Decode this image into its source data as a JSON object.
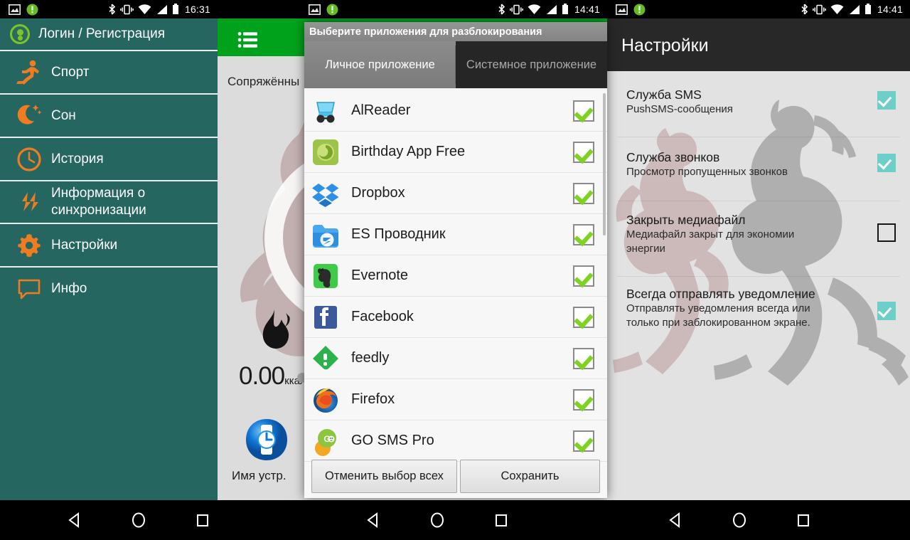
{
  "panels": {
    "drawer": {
      "statusbar": {
        "clock": "16:31",
        "icons_left": [
          "image-icon",
          "alert-badge-icon"
        ],
        "icons_right": [
          "bluetooth-icon",
          "vibrate-icon",
          "wifi-icon",
          "signal-icon",
          "battery-icon"
        ]
      },
      "header": {
        "label": "Логин / Регистрация",
        "icon": "account-avatar-icon"
      },
      "items": [
        {
          "label": "Спорт",
          "icon": "runner-icon"
        },
        {
          "label": "Сон",
          "icon": "moon-stars-icon"
        },
        {
          "label": "История",
          "icon": "clock-icon"
        },
        {
          "label": "Информация о синхронизации",
          "icon": "sync-icon"
        },
        {
          "label": "Настройки",
          "icon": "gear-icon"
        },
        {
          "label": "Инфо",
          "icon": "speech-bubble-icon"
        }
      ]
    },
    "tracker": {
      "appbar_icon": "list-menu-icon",
      "paired_label": "Сопряжённы",
      "calories_value": "0.00",
      "calories_unit": "ккал",
      "flame_icon": "flame-icon",
      "device_icon": "watch-icon",
      "device_label": "Имя устр."
    },
    "settings": {
      "statusbar": {
        "clock": "14:41",
        "icons_left": [
          "image-icon",
          "alert-badge-icon"
        ],
        "icons_right": [
          "bluetooth-icon",
          "vibrate-icon",
          "wifi-icon",
          "signal-icon",
          "battery-icon"
        ]
      },
      "title": "Настройки",
      "rows": [
        {
          "title": "Служба SMS",
          "subtitle": "PushSMS-сообщения",
          "checked": true
        },
        {
          "title": "Служба звонков",
          "subtitle": "Просмотр пропущенных звонков",
          "checked": true
        },
        {
          "title": "Закрыть медиафайл",
          "subtitle": "Медиафайл закрыт для экономии энергии",
          "checked": false
        },
        {
          "title": "Всегда отправлять уведомление",
          "subtitle": "Отправлять уведомления всегда или только при заблокированном экране.",
          "checked": true
        }
      ]
    }
  },
  "dialog": {
    "title": "Выберите приложения для разблокирования",
    "tabs": [
      {
        "label": "Личное приложение",
        "active": true
      },
      {
        "label": "Системное приложение",
        "active": false
      }
    ],
    "apps": [
      {
        "name": "AlReader",
        "icon": "alreader-icon",
        "checked": true
      },
      {
        "name": "Birthday App Free",
        "icon": "birthday-icon",
        "checked": true
      },
      {
        "name": "Dropbox",
        "icon": "dropbox-icon",
        "checked": true
      },
      {
        "name": "ES Проводник",
        "icon": "es-explorer-icon",
        "checked": true
      },
      {
        "name": "Evernote",
        "icon": "evernote-icon",
        "checked": true
      },
      {
        "name": "Facebook",
        "icon": "facebook-icon",
        "checked": true
      },
      {
        "name": "feedly",
        "icon": "feedly-icon",
        "checked": true
      },
      {
        "name": "Firefox",
        "icon": "firefox-icon",
        "checked": true
      },
      {
        "name": "GO SMS Pro",
        "icon": "gosms-icon",
        "checked": true
      }
    ],
    "buttons": {
      "deselect_all": "Отменить выбор всех",
      "save": "Сохранить"
    }
  },
  "navbar": {
    "buttons": [
      "back-icon",
      "home-icon",
      "recents-icon"
    ]
  },
  "colors": {
    "drawer_teal": "#256660",
    "accent_orange": "#f07c22",
    "appbar_green": "#00a21c",
    "checkbox_green": "#7ed321",
    "settings_check_teal": "#6ecfc9",
    "dark_appbar": "#282828"
  }
}
